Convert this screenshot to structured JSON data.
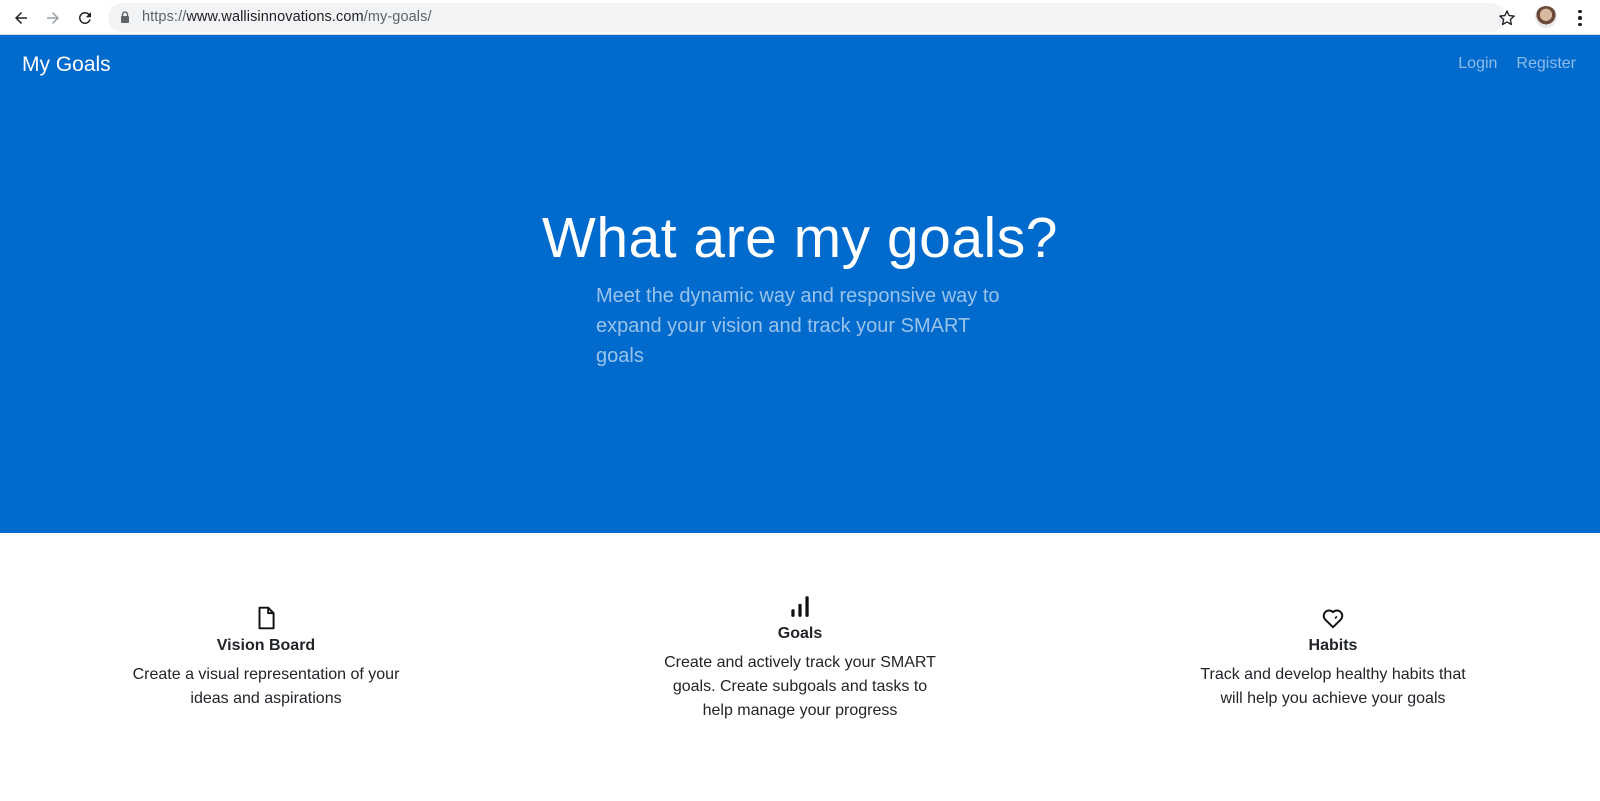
{
  "browser": {
    "url_scheme": "https://",
    "url_host": "www.wallisinnovations.com",
    "url_path": "/my-goals/"
  },
  "navbar": {
    "brand": "My Goals",
    "links": [
      {
        "label": "Login"
      },
      {
        "label": "Register"
      }
    ]
  },
  "hero": {
    "title": "What are my goals?",
    "subtitle": "Meet the dynamic way and responsive way to expand your vision and track your SMART goals"
  },
  "features": [
    {
      "icon": "file-icon",
      "title": "Vision Board",
      "text": "Create a visual representation of your ideas and aspirations"
    },
    {
      "icon": "bar-chart-icon",
      "title": "Goals",
      "text": "Create and actively track your SMART goals. Create subgoals and tasks to help manage your progress"
    },
    {
      "icon": "heart-icon",
      "title": "Habits",
      "text": "Track and develop healthy habits that will help you achieve your goals"
    }
  ],
  "colors": {
    "hero_bg": "#006acd",
    "text": "#212529"
  }
}
